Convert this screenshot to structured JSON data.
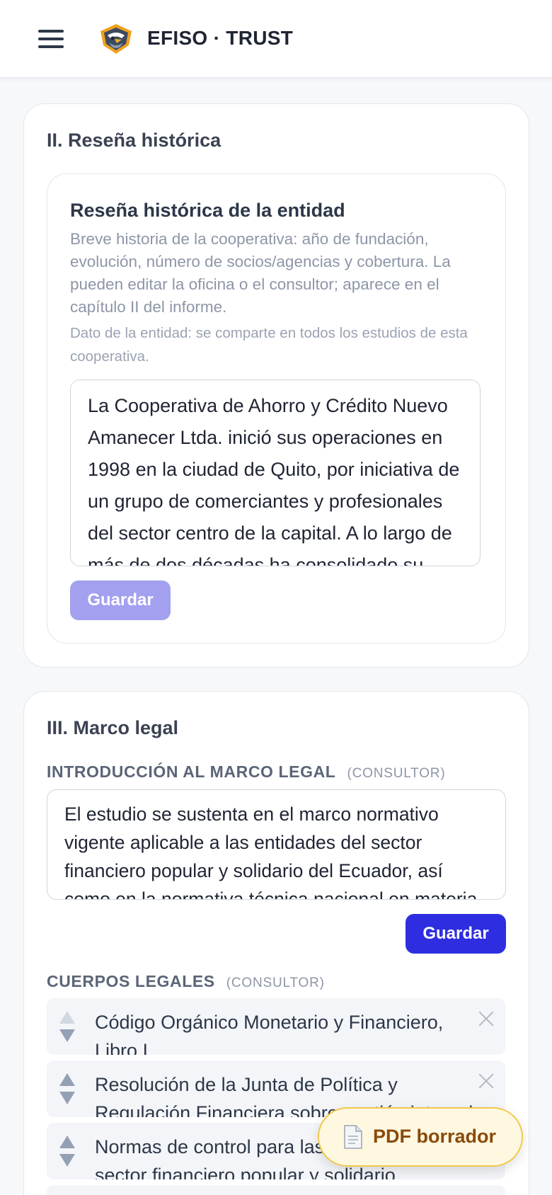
{
  "header": {
    "brand": "EFISO · TRUST",
    "menu_icon": "hamburger-menu-icon",
    "logo_icon": "eagle-shield-logo"
  },
  "section2": {
    "title": "II. Reseña histórica",
    "field": {
      "title": "Reseña histórica de la entidad",
      "help": "Breve historia de la cooperativa: año de fundación, evolución, número de socios/agencias y cobertura. La pueden editar la oficina o el consultor; aparece en el capítulo II del informe.",
      "note": "Dato de la entidad: se comparte en todos los estudios de esta cooperativa.",
      "value": "La Cooperativa de Ahorro y Crédito Nuevo Amanecer Ltda. inició sus operaciones en 1998 en la ciudad de Quito, por iniciativa de un grupo de comerciantes y profesionales del sector centro de la capital. A lo largo de más de dos décadas ha consolidado su presencia en la región.",
      "save_label": "Guardar"
    }
  },
  "section3": {
    "title": "III. Marco legal",
    "intro": {
      "label": "INTRODUCCIÓN AL MARCO LEGAL",
      "tag": "(CONSULTOR)",
      "value": "El estudio se sustenta en el marco normativo vigente aplicable a las entidades del sector financiero popular y solidario del Ecuador, así como en la normativa técnica nacional en materia de riesgos.",
      "save_label": "Guardar"
    },
    "bodies": {
      "label": "CUERPOS LEGALES",
      "tag": "(CONSULTOR)",
      "items": [
        {
          "text": "Código Orgánico Monetario y Financiero, Libro I"
        },
        {
          "text": "Resolución de la Junta de Política y Regulación Financiera sobre gestión integral de riesgos"
        },
        {
          "text": "Normas de control para las entidades del sector financiero popular y solidario"
        }
      ]
    }
  },
  "fab": {
    "label": "PDF borrador",
    "icon": "document-icon"
  },
  "colors": {
    "primary": "#2e2ee0",
    "primary_disabled": "#a3a0f0",
    "fab_bg": "#fff8e1",
    "fab_border": "#f2c94c",
    "fab_text": "#8a4a0a"
  }
}
